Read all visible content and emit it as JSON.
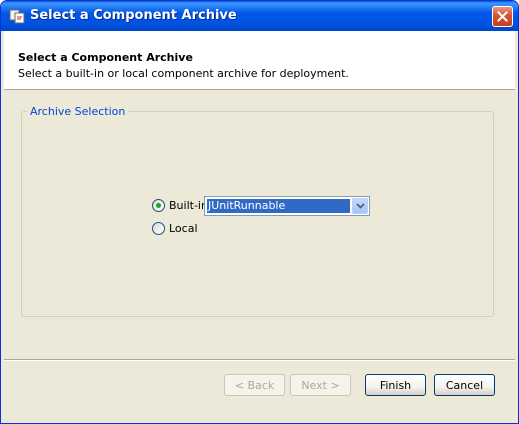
{
  "window": {
    "title": "Select a Component Archive"
  },
  "header": {
    "title": "Select a Component Archive",
    "description": "Select a built-in or local component archive for deployment."
  },
  "archive_selection": {
    "legend": "Archive Selection",
    "builtin": {
      "label": "Built-in",
      "selected": true
    },
    "local": {
      "label": "Local",
      "selected": false
    },
    "combo": {
      "value": "JUnitRunnable"
    }
  },
  "buttons": {
    "back": "< Back",
    "next": "Next >",
    "finish": "Finish",
    "cancel": "Cancel"
  },
  "colors": {
    "titlebar": "#0054e3",
    "accent_blue": "#316ac5",
    "legend_text": "#0046d5",
    "radio_dot": "#21a121",
    "close_button": "#d8522e"
  },
  "icons": [
    "app-icon",
    "close-icon",
    "chevron-down-icon"
  ]
}
